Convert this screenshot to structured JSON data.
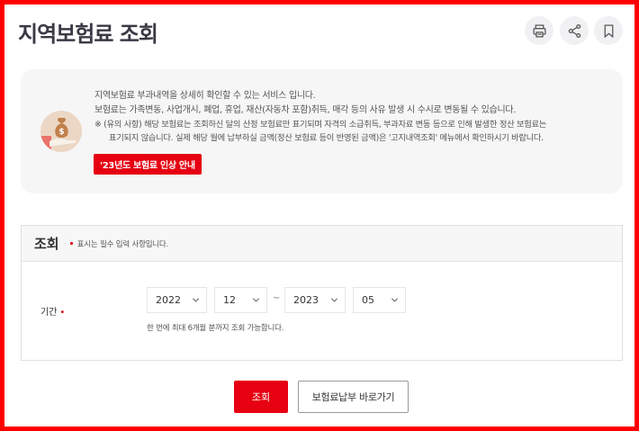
{
  "header": {
    "title": "지역보험료 조회",
    "print_icon": "printer-icon",
    "share_icon": "share-icon",
    "bookmark_icon": "bookmark-icon"
  },
  "notice": {
    "icon": "money-bag-hand-icon",
    "lines": [
      "지역보험료 부과내역을 상세히 확인할 수 있는 서비스 입니다.",
      "보험료는 가족변동, 사업개시, 폐업, 휴업, 재산(자동차 포함)취득, 매각 등의 사유 발생 시 수시로 변동될 수 있습니다.",
      "※ (유의 사항) 해당 보험료는 조회하신 달의 산정 보험료만 표기되며 자격의 소급취득, 부과자료 변동 등으로 인해 발생한 정산 보험료는",
      "표기되지 않습니다. 실제 해당 월에 납부하실 금액(정산 보험료 등이 반영된 금액)은 '고지내역조회' 메뉴에서 확인하시기 바랍니다."
    ],
    "button_label": "'23년도 보험료 인상 안내"
  },
  "query": {
    "title": "조회",
    "required_note": "표시는 필수 입력 사항입니다.",
    "period_label": "기간",
    "required_mark": "•",
    "start_year": "2022",
    "start_month": "12",
    "separator": "~",
    "end_year": "2023",
    "end_month": "05",
    "help_text": "한 번에 최대 6개월 분까지 조회 가능합니다."
  },
  "actions": {
    "search_label": "조회",
    "payment_label": "보험료납부 바로가기"
  },
  "colors": {
    "accent": "#e60012",
    "frame": "#ff0000",
    "notice_bg": "#f6f6f7"
  }
}
